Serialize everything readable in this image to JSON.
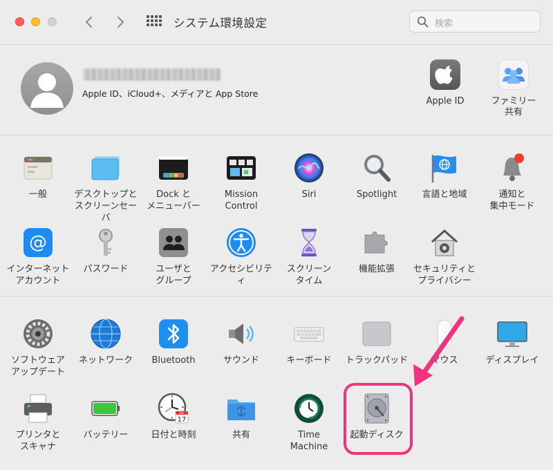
{
  "window": {
    "title": "システム環境設定"
  },
  "search": {
    "placeholder": "検索"
  },
  "account": {
    "subtitle": "Apple ID、iCloud+、メディアと App Store",
    "items": [
      {
        "label": "Apple ID",
        "icon": "apple-logo-icon"
      },
      {
        "label": "ファミリー\n共有",
        "icon": "family-icon"
      }
    ]
  },
  "panes_row1": [
    {
      "label": "一般",
      "icon": "general-icon"
    },
    {
      "label": "デスクトップと\nスクリーンセーバ",
      "icon": "desktop-icon"
    },
    {
      "label": "Dock と\nメニューバー",
      "icon": "dock-icon"
    },
    {
      "label": "Mission\nControl",
      "icon": "mission-control-icon"
    },
    {
      "label": "Siri",
      "icon": "siri-icon"
    },
    {
      "label": "Spotlight",
      "icon": "spotlight-icon"
    },
    {
      "label": "言語と地域",
      "icon": "language-flag-icon"
    },
    {
      "label": "通知と\n集中モード",
      "icon": "notification-bell-icon"
    }
  ],
  "panes_row2": [
    {
      "label": "インターネット\nアカウント",
      "icon": "internet-accounts-icon"
    },
    {
      "label": "パスワード",
      "icon": "key-icon"
    },
    {
      "label": "ユーザと\nグループ",
      "icon": "users-icon"
    },
    {
      "label": "アクセシビリティ",
      "icon": "accessibility-icon"
    },
    {
      "label": "スクリーン\nタイム",
      "icon": "hourglass-icon"
    },
    {
      "label": "機能拡張",
      "icon": "puzzle-icon"
    },
    {
      "label": "セキュリティと\nプライバシー",
      "icon": "security-house-icon"
    }
  ],
  "panes_row3": [
    {
      "label": "ソフトウェア\nアップデート",
      "icon": "software-update-gear-icon"
    },
    {
      "label": "ネットワーク",
      "icon": "network-globe-icon"
    },
    {
      "label": "Bluetooth",
      "icon": "bluetooth-icon"
    },
    {
      "label": "サウンド",
      "icon": "speaker-icon"
    },
    {
      "label": "キーボード",
      "icon": "keyboard-icon"
    },
    {
      "label": "トラックパッド",
      "icon": "trackpad-icon"
    },
    {
      "label": "マウス",
      "icon": "mouse-icon"
    },
    {
      "label": "ディスプレイ",
      "icon": "display-icon"
    }
  ],
  "panes_row4": [
    {
      "label": "プリンタと\nスキャナ",
      "icon": "printer-icon"
    },
    {
      "label": "バッテリー",
      "icon": "battery-icon"
    },
    {
      "label": "日付と時刻",
      "icon": "clock-calendar-icon"
    },
    {
      "label": "共有",
      "icon": "sharing-folder-icon"
    },
    {
      "label": "Time\nMachine",
      "icon": "time-machine-icon"
    },
    {
      "label": "起動ディスク",
      "icon": "startup-disk-icon"
    }
  ],
  "calendar_icon": {
    "month": "JUL",
    "day": "17"
  },
  "colors": {
    "highlight": "#f0337e",
    "accent": "#1e8cf0"
  }
}
